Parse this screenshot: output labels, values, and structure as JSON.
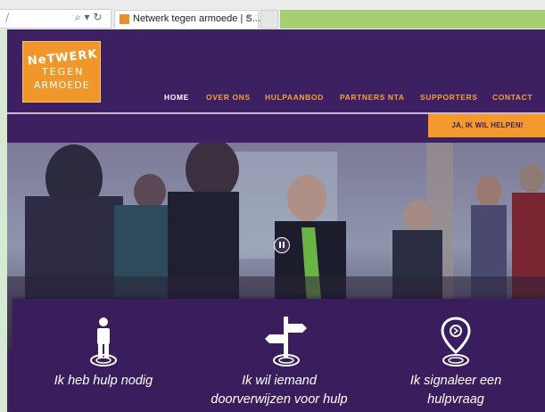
{
  "browser": {
    "address_text": "/",
    "address_icons": "⌕ ▾ ↻",
    "tab_title": "Netwerk tegen armoede | S...",
    "tab_close": "×"
  },
  "site": {
    "logo_lines": [
      "NeTWERK",
      "TEGEN",
      "ARMOEDE"
    ],
    "nav": [
      {
        "label": "HOME",
        "active": true
      },
      {
        "label": "OVER ONS"
      },
      {
        "label": "HULPAANBOD"
      },
      {
        "label": "PARTNERS NTA"
      },
      {
        "label": "SUPPORTERS"
      },
      {
        "label": "CONTACT"
      }
    ],
    "help_button": "JA, IK WIL HELPEN!",
    "cards": [
      {
        "icon": "person-icon",
        "line1": "Ik heb hulp nodig",
        "line2": ""
      },
      {
        "icon": "signpost-icon",
        "line1": "Ik wil iemand",
        "line2": "doorverwijzen voor hulp"
      },
      {
        "icon": "location-pin-icon",
        "line1": "Ik signaleer een",
        "line2": "hulpvraag"
      }
    ]
  },
  "colors": {
    "purple": "#3c2060",
    "orange": "#f29a2e",
    "browser_green": "#a9cd72"
  }
}
